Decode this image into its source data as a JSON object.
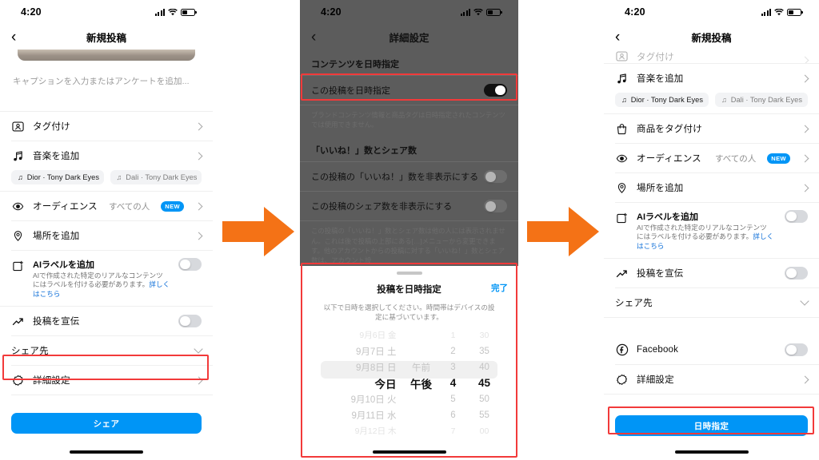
{
  "status_bar": {
    "time": "4:20",
    "signal_icon": "cellular-bars-icon",
    "wifi_icon": "wifi-icon",
    "battery_icon": "battery-icon"
  },
  "colors": {
    "accent_blue": "#0095f6",
    "highlight_red": "#f23a3a",
    "arrow_orange": "#f47216",
    "dim_overlay": "#5c5c5c"
  },
  "panel1": {
    "nav": {
      "back": "‹",
      "title": "新規投稿"
    },
    "caption_placeholder": "キャプションを入力またはアンケートを追加...",
    "rows": [
      {
        "icon": "tag-person-icon",
        "label": "タグ付け",
        "accessory": "chevron"
      },
      {
        "icon": "music-note-icon",
        "label": "音楽を追加",
        "accessory": "chevron"
      }
    ],
    "music_chips": [
      {
        "icon": "music-note-icon",
        "label": "Dior · Tony Dark Eyes"
      },
      {
        "icon": "music-note-icon",
        "label": "Dali · Tony Dark Eyes"
      }
    ],
    "audience": {
      "icon": "audience-icon",
      "label": "オーディエンス",
      "value": "すべての人",
      "badge": "NEW",
      "accessory": "chevron"
    },
    "location": {
      "icon": "location-pin-icon",
      "label": "場所を追加",
      "accessory": "chevron"
    },
    "ai_label": {
      "icon": "ai-label-icon",
      "title": "AIラベルを追加",
      "desc_1": "AIで作成された特定のリアルなコンテンツ",
      "desc_2": "にはラベルを付ける必要があります。",
      "desc_link": "詳しくはこちら",
      "toggle": "off"
    },
    "promote": {
      "icon": "trending-up-icon",
      "label": "投稿を宣伝",
      "toggle": "off"
    },
    "share_to": {
      "label": "シェア先",
      "accessory": "chevron-down"
    },
    "advanced": {
      "icon": "gear-burst-icon",
      "label": "詳細設定",
      "accessory": "chevron",
      "highlighted": true
    },
    "cta": "シェア"
  },
  "panel2": {
    "nav": {
      "back": "‹",
      "title": "詳細設定"
    },
    "section_schedule": "コンテンツを日時指定",
    "schedule_row": {
      "label": "この投稿を日時指定",
      "toggle": "on",
      "highlighted": true
    },
    "schedule_note": "ブランドコンテンツ情報と商品タグは日時指定されたコンテンツでは使用できません。",
    "section_likes": "「いいね！」数とシェア数",
    "hide_likes": {
      "label": "この投稿の「いいね！」数を非表示にする",
      "toggle": "off"
    },
    "hide_shares": {
      "label": "この投稿のシェア数を非表示にする",
      "toggle": "off"
    },
    "likes_note": "この投稿の「いいね！」数とシェア数は他の人には表示されません。これは後で投稿の上部にある[…]メニューから変更できます。他のアカウントからの投稿に対する「いいね！」数とシェア数は、アカウント設",
    "sheet": {
      "title": "投稿を日時指定",
      "done": "完了",
      "description": "以下で日時を選択してください。時間帯はデバイスの設定に基づいています。",
      "highlighted": true,
      "picker_rows": [
        {
          "date": "9月6日 金",
          "ampm": "",
          "hour": "1",
          "minute": "30",
          "state": "faint"
        },
        {
          "date": "9月7日 土",
          "ampm": "",
          "hour": "2",
          "minute": "35",
          "state": "normal"
        },
        {
          "date": "9月8日 日",
          "ampm": "午前",
          "hour": "3",
          "minute": "40",
          "state": "normal"
        },
        {
          "date": "今日",
          "ampm": "午後",
          "hour": "4",
          "minute": "45",
          "state": "selected"
        },
        {
          "date": "9月10日 火",
          "ampm": "",
          "hour": "5",
          "minute": "50",
          "state": "normal"
        },
        {
          "date": "9月11日 水",
          "ampm": "",
          "hour": "6",
          "minute": "55",
          "state": "normal"
        },
        {
          "date": "9月12日 木",
          "ampm": "",
          "hour": "7",
          "minute": "00",
          "state": "faint"
        }
      ]
    }
  },
  "panel3": {
    "nav": {
      "back": "‹",
      "title": "新規投稿"
    },
    "partial_row": {
      "icon": "tag-person-icon",
      "label": "タグ付け",
      "accessory": "chevron"
    },
    "music": {
      "icon": "music-note-icon",
      "label": "音楽を追加",
      "accessory": "chevron"
    },
    "music_chips": [
      {
        "icon": "music-note-icon",
        "label": "Dior · Tony Dark Eyes"
      },
      {
        "icon": "music-note-icon",
        "label": "Dali · Tony Dark Eyes"
      }
    ],
    "product_tag": {
      "icon": "shopping-bag-icon",
      "label": "商品をタグ付け",
      "accessory": "chevron"
    },
    "audience": {
      "icon": "audience-icon",
      "label": "オーディエンス",
      "value": "すべての人",
      "badge": "NEW",
      "accessory": "chevron"
    },
    "location": {
      "icon": "location-pin-icon",
      "label": "場所を追加",
      "accessory": "chevron"
    },
    "ai_label": {
      "icon": "ai-label-icon",
      "title": "AIラベルを追加",
      "desc_1": "AIで作成された特定のリアルなコンテンツ",
      "desc_2": "にはラベルを付ける必要があります。",
      "desc_link": "詳しくはこちら",
      "toggle": "off"
    },
    "promote": {
      "icon": "trending-up-icon",
      "label": "投稿を宣伝",
      "toggle": "off"
    },
    "share_to": {
      "label": "シェア先",
      "accessory": "chevron-down"
    },
    "facebook": {
      "icon": "facebook-icon",
      "label": "Facebook",
      "toggle": "off"
    },
    "advanced": {
      "icon": "gear-burst-icon",
      "label": "詳細設定",
      "accessory": "chevron"
    },
    "cta": {
      "label": "日時指定",
      "highlighted": true
    }
  },
  "arrows": [
    {
      "name": "flow-arrow-1",
      "direction": "right"
    },
    {
      "name": "flow-arrow-2",
      "direction": "right"
    }
  ]
}
